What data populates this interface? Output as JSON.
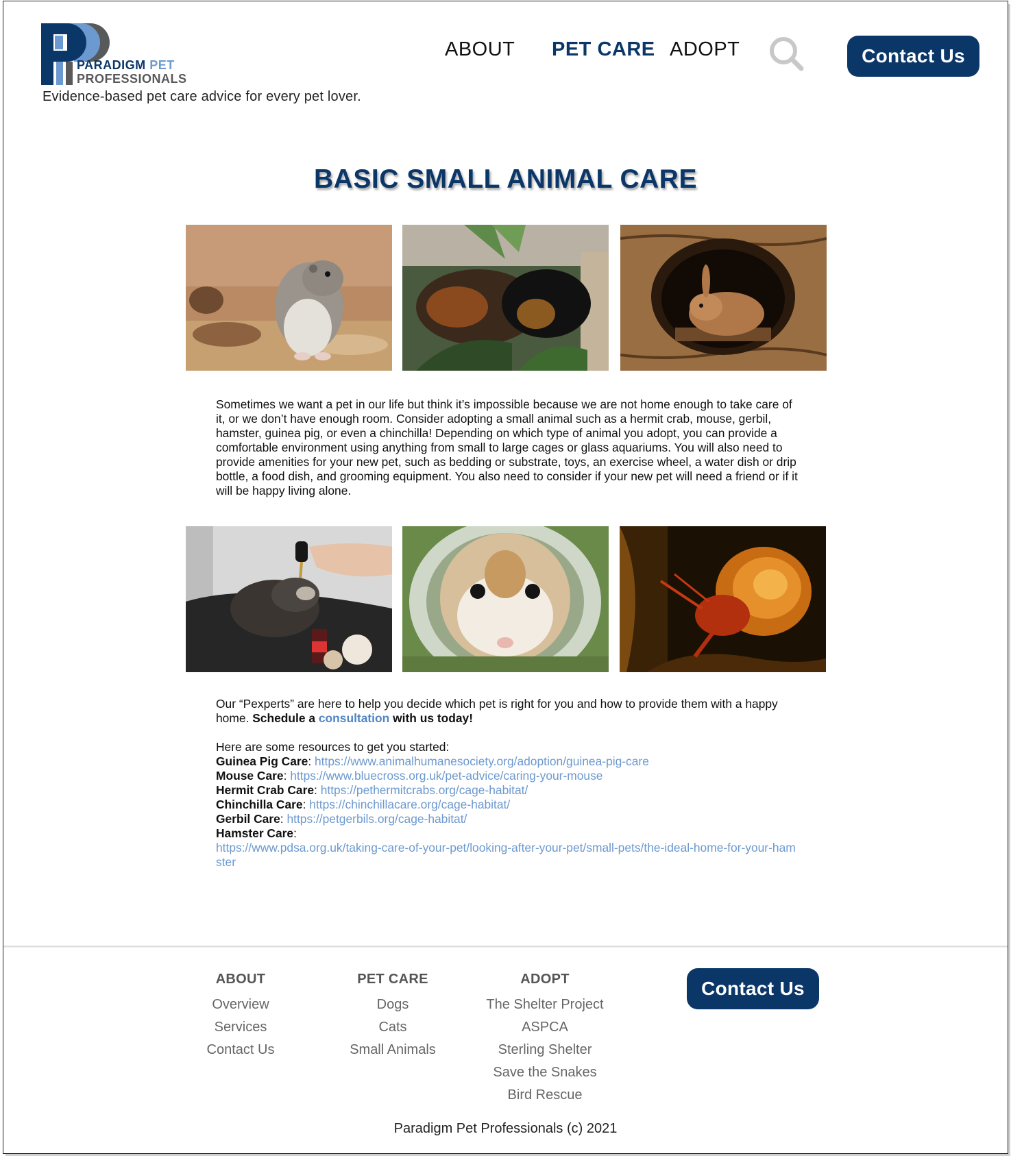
{
  "header": {
    "logo_line1": "PARADIGM",
    "logo_line1b": "PET",
    "logo_line2": "PROFESSIONALS",
    "tagline": "Evidence-based pet care advice for every pet lover.",
    "nav": [
      "ABOUT",
      "PET CARE",
      "ADOPT"
    ],
    "contact_label": "Contact Us",
    "search_icon": "search-icon"
  },
  "colors": {
    "brand": "#0b3768",
    "link": "#6c99cf",
    "logo_light": "#6c99cf",
    "logo_gray": "#58595b"
  },
  "main": {
    "title": "BASIC SMALL ANIMAL CARE",
    "photos_row1": [
      "hamster",
      "guinea-pigs",
      "rabbit-in-log"
    ],
    "photos_row2": [
      "ferret-with-dropper",
      "hamster-closeup",
      "hermit-crab"
    ],
    "intro": "Sometimes we want a pet in our life but think it’s impossible because we are not home enough to take care of it, or we don’t have enough room. Consider adopting a small animal such as a hermit crab, mouse, gerbil, hamster, guinea pig, or even a chinchilla! Depending on which type of animal you adopt, you can provide a comfortable environment using anything from small to large cages or glass aquariums. You will also need to provide amenities for your new pet, such as bedding or substrate, toys, an exercise wheel, a water dish or drip bottle, a food dish, and grooming equipment. You also need to consider if your new pet will need a friend or if it will be happy living alone.",
    "pexperts_text": "Our “Pexperts” are here to help you decide which pet is right for you and how to provide them with a happy home.",
    "schedule_pre": "Schedule a",
    "consultation_link": "consultation",
    "schedule_post": "with us today!",
    "resources_intro": "Here are some resources to get you started:",
    "resources": [
      {
        "label": "Guinea Pig Care",
        "url": "https://www.animalhumanesociety.org/adoption/guinea-pig-care"
      },
      {
        "label": "Mouse Care",
        "url": "https://www.bluecross.org.uk/pet-advice/caring-your-mouse"
      },
      {
        "label": "Hermit Crab Care",
        "url": "https://pethermitcrabs.org/cage-habitat/"
      },
      {
        "label": "Chinchilla Care",
        "url": "https://chinchillacare.org/cage-habitat/"
      },
      {
        "label": "Gerbil Care",
        "url": "https://petgerbils.org/cage-habitat/"
      },
      {
        "label": "Hamster Care",
        "url": "https://www.pdsa.org.uk/taking-care-of-your-pet/looking-after-your-pet/small-pets/the-ideal-home-for-your-hamster"
      }
    ]
  },
  "footer": {
    "columns": [
      {
        "heading": "ABOUT",
        "items": [
          "Overview",
          "Services",
          "Contact Us"
        ]
      },
      {
        "heading": "PET CARE",
        "items": [
          "Dogs",
          "Cats",
          "Small Animals"
        ]
      },
      {
        "heading": "ADOPT",
        "items": [
          "The Shelter Project",
          "ASPCA",
          "Sterling Shelter",
          "Save the Snakes",
          "Bird Rescue"
        ]
      }
    ],
    "contact_label": "Contact Us",
    "copyright": "Paradigm Pet Professionals (c) 2021"
  }
}
